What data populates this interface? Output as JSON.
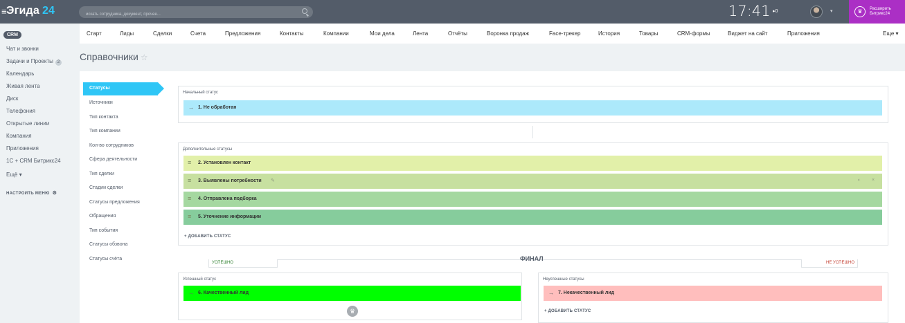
{
  "header": {
    "brand_name": "Эгида",
    "brand_number": "24",
    "search_placeholder": "искать сотрудника, документ, прочее...",
    "clock": "17:41",
    "flag_indicator": "▸0",
    "upgrade_label": "Расширить Битрикс24",
    "icons": [
      "hamburger-icon",
      "search-icon",
      "flag-icon",
      "avatar",
      "crown-icon"
    ]
  },
  "sidebar": {
    "crm_badge": "CRM",
    "items": [
      {
        "label": "Чат и звонки"
      },
      {
        "label": "Задачи и Проекты",
        "counter": "2"
      },
      {
        "label": "Календарь"
      },
      {
        "label": "Живая лента"
      },
      {
        "label": "Диск"
      },
      {
        "label": "Телефония"
      },
      {
        "label": "Открытые линии"
      },
      {
        "label": "Компания"
      },
      {
        "label": "Приложения"
      },
      {
        "label": "1С + CRM Битрикс24"
      },
      {
        "label": "Ещё ▾"
      }
    ],
    "configure_label": "НАСТРОИТЬ МЕНЮ"
  },
  "topnav": {
    "items": [
      "Старт",
      "Лиды",
      "Сделки",
      "Счета",
      "Предложения",
      "Контакты",
      "Компании",
      "Мои дела",
      "Лента",
      "Отчёты",
      "Воронка продаж",
      "Face-трекер",
      "История",
      "Товары",
      "CRM-формы",
      "Виджет на сайт",
      "Приложения"
    ],
    "more_label": "Еще ▾"
  },
  "page": {
    "title": "Справочники",
    "star": "☆"
  },
  "refs_menu": {
    "active": "Статусы",
    "items": [
      "Источники",
      "Тип контакта",
      "Тип компании",
      "Кол-во сотрудников",
      "Сфера деятельности",
      "Тип сделки",
      "Стадии сделки",
      "Статусы предложения",
      "Обращения",
      "Тип события",
      "Статусы обзвона",
      "Статусы счёта"
    ]
  },
  "initial_box": {
    "title": "Начальный статус",
    "status": {
      "label": "1. Не обработан",
      "color": "#ace9fb"
    }
  },
  "additional_box": {
    "title": "Дополнительные статусы",
    "statuses": [
      {
        "label": "2. Установлен контакт",
        "color": "#e2f0a9"
      },
      {
        "label": "3. Выявлены потребности",
        "color": "#c7e0a0"
      },
      {
        "label": "4. Отправлена подборка",
        "color": "#a5d8a0"
      },
      {
        "label": "5. Уточнение информации",
        "color": "#86cc9c"
      }
    ],
    "add_label": "+ ДОБАВИТЬ СТАТУС"
  },
  "final": {
    "label": "ФИНАЛ",
    "success_tab": "УСПЕШНО",
    "fail_tab": "НЕ УСПЕШНО"
  },
  "success_box": {
    "title": "Успешный статус",
    "status": {
      "label": "6. Качественный лид",
      "color": "#00ff00"
    }
  },
  "fail_box": {
    "title": "Неуспешные статусы",
    "status": {
      "label": "7. Некачественный лид",
      "color": "#ffbebd"
    },
    "add_label": "+ ДОБАВИТЬ СТАТУС"
  }
}
